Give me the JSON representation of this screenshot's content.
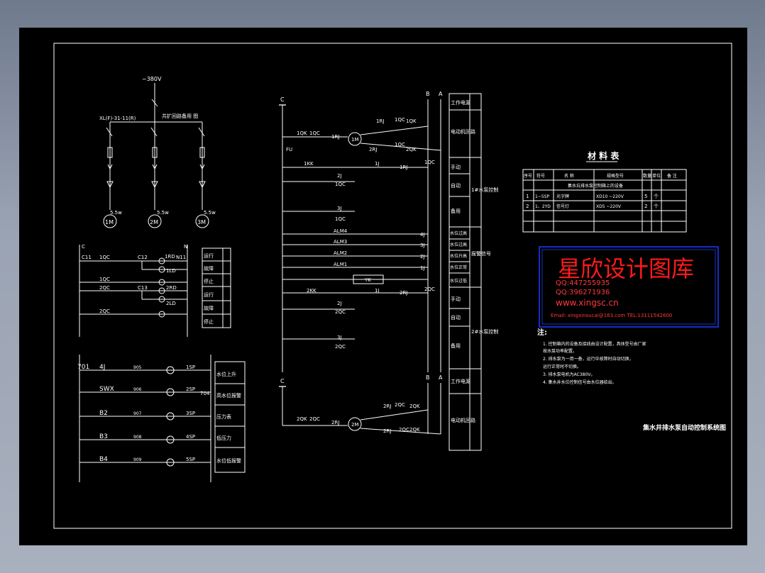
{
  "drawing": {
    "motor_circuit": {
      "supply": "~380V",
      "breaker": "XL(F)-31-11(R)",
      "cabinet": "共扩回路备用 图",
      "motors": [
        {
          "label": "1M",
          "power": "5.5w"
        },
        {
          "label": "2M",
          "power": "5.5w"
        },
        {
          "label": "3M",
          "power": "5.5w"
        }
      ]
    },
    "signal_circuit": {
      "rail_left": "C",
      "rail_right": "N",
      "labels": [
        "C11",
        "1QC",
        "C12",
        "1RD",
        "N11",
        "1LD",
        "1QC",
        "2QC",
        "C13",
        "2RD",
        "2LD",
        "2QC"
      ],
      "table": [
        "运行",
        "故障",
        "停止",
        "运行",
        "故障",
        "停止"
      ]
    },
    "alarm_circuit": {
      "rows": [
        {
          "label": "701",
          "relay": "4J",
          "wire": "905",
          "lamp": "1SP"
        },
        {
          "label": "SWX",
          "relay": "",
          "wire": "906",
          "lamp": "2SP"
        },
        {
          "label": "B2",
          "relay": "",
          "wire": "907",
          "lamp": "3SP"
        },
        {
          "label": "B3",
          "relay": "",
          "wire": "908",
          "lamp": "4SP"
        },
        {
          "label": "B4",
          "relay": "",
          "wire": "909",
          "lamp": "5SP"
        }
      ],
      "wire_out": "704",
      "table": [
        "水位上升",
        "高水位报警",
        "压力表",
        "低压力",
        "水位低报警"
      ]
    },
    "control_circuit": {
      "rail_labels": [
        "C",
        "B",
        "A"
      ],
      "labels_top": [
        "1QK",
        "1QC",
        "1RJ",
        "1M",
        "1RJ",
        "1QC",
        "1QK",
        "2RJ",
        "1QC",
        "2QK",
        "FU",
        "1KK",
        "1J",
        "1RJ",
        "1QC",
        "2J",
        "1QC",
        "3J",
        "1QC",
        "ALM4",
        "ALM3",
        "ALM2",
        "ALM1",
        "4J",
        "3J",
        "2J",
        "1J",
        "YK",
        "2KK",
        "1J",
        "2RJ",
        "2QC",
        "2J",
        "2QC",
        "3J",
        "2QC"
      ],
      "labels_bottom": [
        "C",
        "B",
        "A",
        "2QK",
        "2QC",
        "2RJ",
        "2M",
        "2RJ",
        "2QC",
        "2QK",
        "2RJ",
        "2QC",
        "2QK"
      ],
      "function_table": [
        "工作电源",
        "电动机回路",
        "手动",
        "自动",
        "备用",
        "水位过高",
        "水位过高",
        "水位升高",
        "水位正常",
        "水位过低",
        "手动",
        "自动",
        "备用",
        "工作电源",
        "电动机回路"
      ],
      "side_labels": [
        "1#水泵控制",
        "报警信号",
        "2#水泵控制"
      ]
    },
    "material_table": {
      "title": "材 料 表",
      "headers": [
        "序号",
        "符号",
        "名 称",
        "规格型号",
        "数量",
        "单位",
        "备 注"
      ],
      "section": "集水坑排水泵控制箱上的设备",
      "rows": [
        {
          "no": "1",
          "symbol": "1~5SP",
          "name": "光字牌",
          "model": "XD10 ~220V",
          "qty": "5",
          "unit": "个"
        },
        {
          "no": "2",
          "symbol": "1、2YD",
          "name": "信号灯",
          "model": "XD5 ~220V",
          "qty": "2",
          "unit": "个"
        }
      ]
    },
    "watermark": {
      "title": "星欣设计图库",
      "qq1": "QQ:447255935",
      "qq2": "QQ:396271936",
      "site": "www.xingsc.cn",
      "contact": "Email: xingxinsucai@163.com  TEL:13111542600"
    },
    "notes": {
      "heading": "注:",
      "items": [
        "1. 控制箱内的设备及接线由设计配置，具体型号由厂家",
        "   按水泵功率配置。",
        "2. 排水泵为一用一备，运行中故障时自动切换，",
        "   运行正常时不切换。",
        "3. 排水泵电机为AC380V。",
        "4. 集水井水位控制信号由水位器给出。"
      ]
    },
    "drawing_title": "集水井排水泵自动控制系统图"
  },
  "colors": {
    "background": "#000000",
    "line": "#ffffff",
    "watermark_border": "#1a3cff",
    "watermark_text": "#ff1a1a",
    "outer": "#8e97a8"
  }
}
